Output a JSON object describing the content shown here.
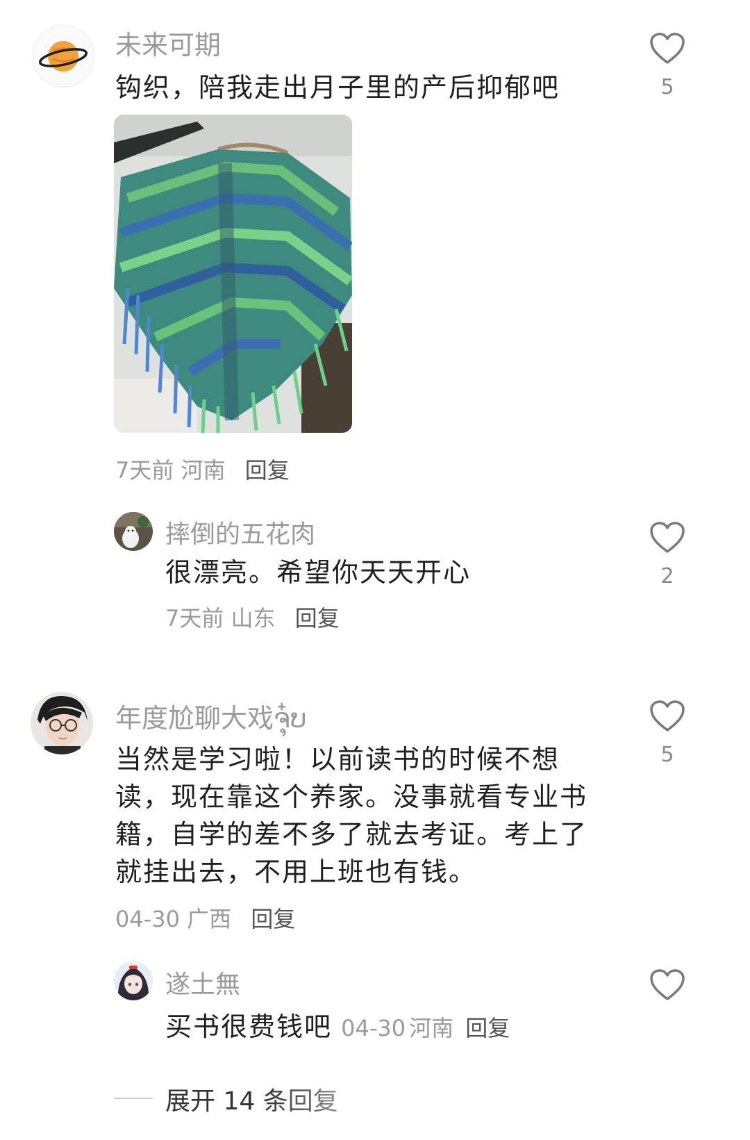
{
  "comments": [
    {
      "username": "未来可期",
      "text": "钩织，陪我走出月子里的产后抑郁吧",
      "time": "7天前",
      "location": "河南",
      "reply_label": "回复",
      "likes": "5",
      "avatar_icon": "planet-icon"
    },
    {
      "username": "摔倒的五花肉",
      "text": "很漂亮。希望你天天开心",
      "time": "7天前",
      "location": "山东",
      "reply_label": "回复",
      "likes": "2",
      "avatar_icon": "cat-photo-avatar"
    },
    {
      "username": "年度尬聊大戏ຈຸ໋ບ",
      "text": "当然是学习啦！以前读书的时候不想读，现在靠这个养家。没事就看专业书籍，自学的差不多了就去考证。考上了就挂出去，不用上班也有钱。",
      "time": "04-30",
      "location": "广西",
      "reply_label": "回复",
      "likes": "5",
      "avatar_icon": "glasses-person-avatar"
    },
    {
      "username": "遂土無",
      "text": "买书很费钱吧",
      "time": "04-30",
      "location": "河南",
      "reply_label": "回复",
      "likes": "",
      "avatar_icon": "anime-girl-avatar"
    }
  ],
  "expand_replies": "展开 14 条回复",
  "colors": {
    "name": "#9a9a9a",
    "text": "#1f1f1f",
    "meta": "#9a9a9a",
    "heart": "#7a7a7a"
  }
}
